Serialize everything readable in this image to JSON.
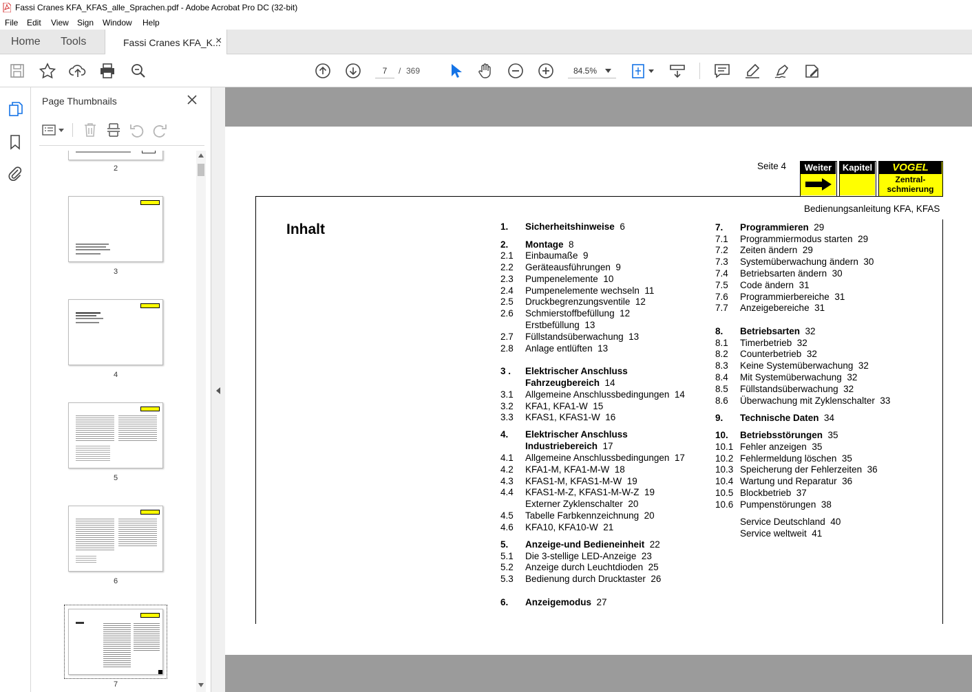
{
  "window": {
    "title": "Fassi Cranes KFA_KFAS_alle_Sprachen.pdf - Adobe Acrobat Pro DC (32-bit)"
  },
  "menu": [
    "File",
    "Edit",
    "View",
    "Sign",
    "Window",
    "Help"
  ],
  "tabs": {
    "home": "Home",
    "tools": "Tools",
    "document": "Fassi Cranes KFA_K...",
    "close": "×"
  },
  "toolbar": {
    "page_current": "7",
    "page_sep": "/",
    "page_total": "369",
    "zoom": "84.5%"
  },
  "panel": {
    "title": "Page Thumbnails",
    "thumbnails": [
      "2",
      "3",
      "4",
      "5",
      "6",
      "7"
    ],
    "selected": "7"
  },
  "document": {
    "seite": "Seite 4",
    "logo": {
      "weiter": "Weiter",
      "kapitel": "Kapitel",
      "vogel": "VOGEL",
      "zentral_1": "Zentral-",
      "zentral_2": "schmierung",
      "yellow": "#ffff00"
    },
    "subtitle": "Bedienungsanleitung KFA, KFAS",
    "heading": "Inhalt",
    "toc_col1": [
      {
        "n": "1.",
        "t": "Sicherheitshinweise",
        "p": "6",
        "bold": true
      },
      {
        "n": "2.",
        "t": "Montage",
        "p": "8",
        "bold": true
      },
      {
        "n": "2.1",
        "t": "Einbaumaße",
        "p": "9"
      },
      {
        "n": "2.2",
        "t": "Geräteausführungen",
        "p": "9"
      },
      {
        "n": "2.3",
        "t": "Pumpenelemente",
        "p": "10"
      },
      {
        "n": "2.4",
        "t": "Pumpenelemente wechseln",
        "p": "11"
      },
      {
        "n": "2.5",
        "t": "Druckbegrenzungsventile",
        "p": "12"
      },
      {
        "n": "2.6",
        "t": "Schmierstoffbefüllung",
        "p": "12"
      },
      {
        "n": "",
        "t": "Erstbefüllung",
        "p": "13"
      },
      {
        "n": "2.7",
        "t": "Füllstandsüberwachung",
        "p": "13"
      },
      {
        "n": "2.8",
        "t": "Anlage entlüften",
        "p": "13"
      },
      {
        "n": "3 .",
        "t": "Elektrischer Anschluss",
        "p": "",
        "bold": true
      },
      {
        "n": "",
        "t": "Fahrzeugbereich",
        "p": "14",
        "bold": true
      },
      {
        "n": "3.1",
        "t": "Allgemeine Anschlussbedingungen",
        "p": "14"
      },
      {
        "n": "3.2",
        "t": "KFA1, KFA1-W",
        "p": "15"
      },
      {
        "n": "3.3",
        "t": "KFAS1, KFAS1-W",
        "p": "16"
      },
      {
        "n": "4.",
        "t": "Elektrischer Anschluss",
        "p": "",
        "bold": true
      },
      {
        "n": "",
        "t": "Industriebereich",
        "p": "17",
        "bold": true
      },
      {
        "n": "4.1",
        "t": "Allgemeine Anschlussbedingungen",
        "p": "17"
      },
      {
        "n": "4.2",
        "t": "KFA1-M, KFA1-M-W",
        "p": "18"
      },
      {
        "n": "4.3",
        "t": "KFAS1-M, KFAS1-M-W",
        "p": "19"
      },
      {
        "n": "4.4",
        "t": "KFAS1-M-Z, KFAS1-M-W-Z",
        "p": "19"
      },
      {
        "n": "",
        "t": "Externer Zyklenschalter",
        "p": "20"
      },
      {
        "n": "4.5",
        "t": "Tabelle Farbkennzeichnung",
        "p": "20"
      },
      {
        "n": "4.6",
        "t": "KFA10, KFA10-W",
        "p": "21"
      },
      {
        "n": "5.",
        "t": "Anzeige-und Bedieneinheit",
        "p": "22",
        "bold": true
      },
      {
        "n": "5.1",
        "t": "Die 3-stellige LED-Anzeige",
        "p": "23"
      },
      {
        "n": "5.2",
        "t": "Anzeige durch Leuchtdioden",
        "p": "25"
      },
      {
        "n": "5.3",
        "t": "Bedienung durch Drucktaster",
        "p": "26"
      },
      {
        "n": "6.",
        "t": "Anzeigemodus",
        "p": "27",
        "bold": true
      }
    ],
    "toc_col2": [
      {
        "n": "7.",
        "t": "Programmieren",
        "p": "29",
        "bold": true
      },
      {
        "n": "7.1",
        "t": "Programmiermodus starten",
        "p": "29"
      },
      {
        "n": "7.2",
        "t": "Zeiten ändern",
        "p": "29"
      },
      {
        "n": "7.3",
        "t": "Systemüberwachung ändern",
        "p": "30"
      },
      {
        "n": "7.4",
        "t": "Betriebsarten ändern",
        "p": "30"
      },
      {
        "n": "7.5",
        "t": "Code ändern",
        "p": "31"
      },
      {
        "n": "7.6",
        "t": "Programmierbereiche",
        "p": "31"
      },
      {
        "n": "7.7",
        "t": "Anzeigebereiche",
        "p": "31"
      },
      {
        "n": "8.",
        "t": "Betriebsarten",
        "p": "32",
        "bold": true
      },
      {
        "n": "8.1",
        "t": "Timerbetrieb",
        "p": "32"
      },
      {
        "n": "8.2",
        "t": "Counterbetrieb",
        "p": "32"
      },
      {
        "n": "8.3",
        "t": "Keine Systemüberwachung",
        "p": "32"
      },
      {
        "n": "8.4",
        "t": "Mit Systemüberwachung",
        "p": "32"
      },
      {
        "n": "8.5",
        "t": "Füllstandsüberwachung",
        "p": "32"
      },
      {
        "n": "8.6",
        "t": "Überwachung mit Zyklenschalter",
        "p": "33"
      },
      {
        "n": "9.",
        "t": "Technische Daten",
        "p": "34",
        "bold": true
      },
      {
        "n": "10.",
        "t": "Betriebsstörungen",
        "p": "35",
        "bold": true
      },
      {
        "n": "10.1",
        "t": "Fehler anzeigen",
        "p": "35"
      },
      {
        "n": "10.2",
        "t": "Fehlermeldung löschen",
        "p": "35"
      },
      {
        "n": "10.3",
        "t": "Speicherung der Fehlerzeiten",
        "p": "36"
      },
      {
        "n": "10.4",
        "t": "Wartung und Reparatur",
        "p": "36"
      },
      {
        "n": "10.5",
        "t": "Blockbetrieb",
        "p": "37"
      },
      {
        "n": "10.6",
        "t": "Pumpenstörungen",
        "p": "38"
      },
      {
        "n": "",
        "t": "Service Deutschland",
        "p": "40"
      },
      {
        "n": "",
        "t": "Service weltweit",
        "p": "41"
      }
    ]
  }
}
